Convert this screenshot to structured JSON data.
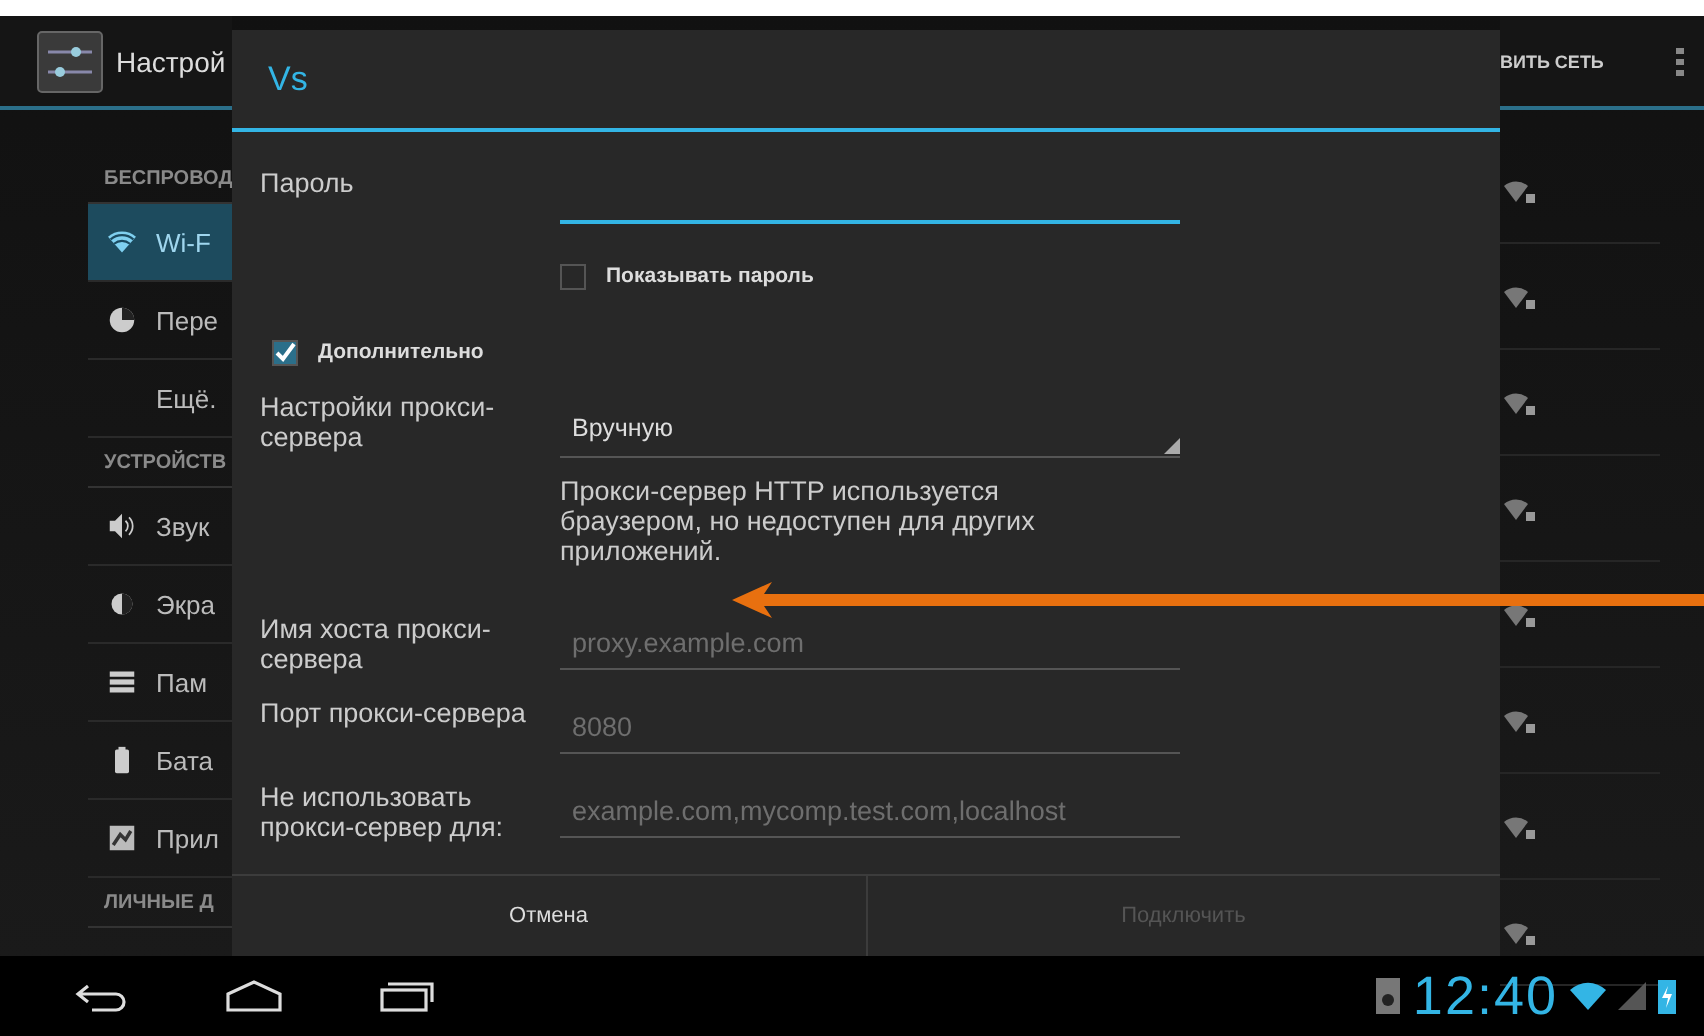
{
  "background_app": {
    "title": "Настрой",
    "action": "ВИТЬ СЕТЬ",
    "sidebar": [
      {
        "kind": "header",
        "label": "БЕСПРОВОД"
      },
      {
        "kind": "wifi",
        "label": "Wi-F",
        "selected": true
      },
      {
        "kind": "data",
        "label": "Пере",
        "selected": false
      },
      {
        "kind": "more",
        "label": "Ещё.",
        "selected": false
      },
      {
        "kind": "header",
        "label": "УСТРОЙСТВ"
      },
      {
        "kind": "sound",
        "label": "Звук",
        "selected": false
      },
      {
        "kind": "display",
        "label": "Экра",
        "selected": false
      },
      {
        "kind": "storage",
        "label": "Пам",
        "selected": false
      },
      {
        "kind": "battery",
        "label": "Бата",
        "selected": false
      },
      {
        "kind": "apps",
        "label": "Прил",
        "selected": false
      },
      {
        "kind": "header",
        "label": "ЛИЧНЫЕ Д"
      }
    ]
  },
  "dialog": {
    "title": "Vs",
    "rows": [
      {
        "kind": "text_field",
        "label": "Пароль",
        "focused": true
      },
      {
        "kind": "sub_checkbox",
        "label": "Показывать пароль",
        "checked": false
      },
      {
        "kind": "checkbox",
        "label": "Дополнительно",
        "checked": true
      },
      {
        "kind": "spinner",
        "label": "Настройки прокси-сервера",
        "value": "Вручную"
      },
      {
        "kind": "note",
        "text": "Прокси-сервер HTTP используется браузером, но недоступен для других приложений."
      },
      {
        "kind": "text_field",
        "label": "Имя хоста прокси-сервера",
        "placeholder": "proxy.example.com",
        "focused": false
      },
      {
        "kind": "text_field",
        "label": "Порт прокси-сервера",
        "placeholder": "8080",
        "focused": false
      },
      {
        "kind": "text_field",
        "label": "Не использовать прокси-сервер для:",
        "placeholder": "example.com,mycomp.test.com,localhost",
        "focused": false
      }
    ],
    "buttons": [
      {
        "label": "Отмена",
        "disabled": false
      },
      {
        "label": "Подключить",
        "disabled": true
      }
    ]
  },
  "status_bar": {
    "time": "12:40"
  }
}
